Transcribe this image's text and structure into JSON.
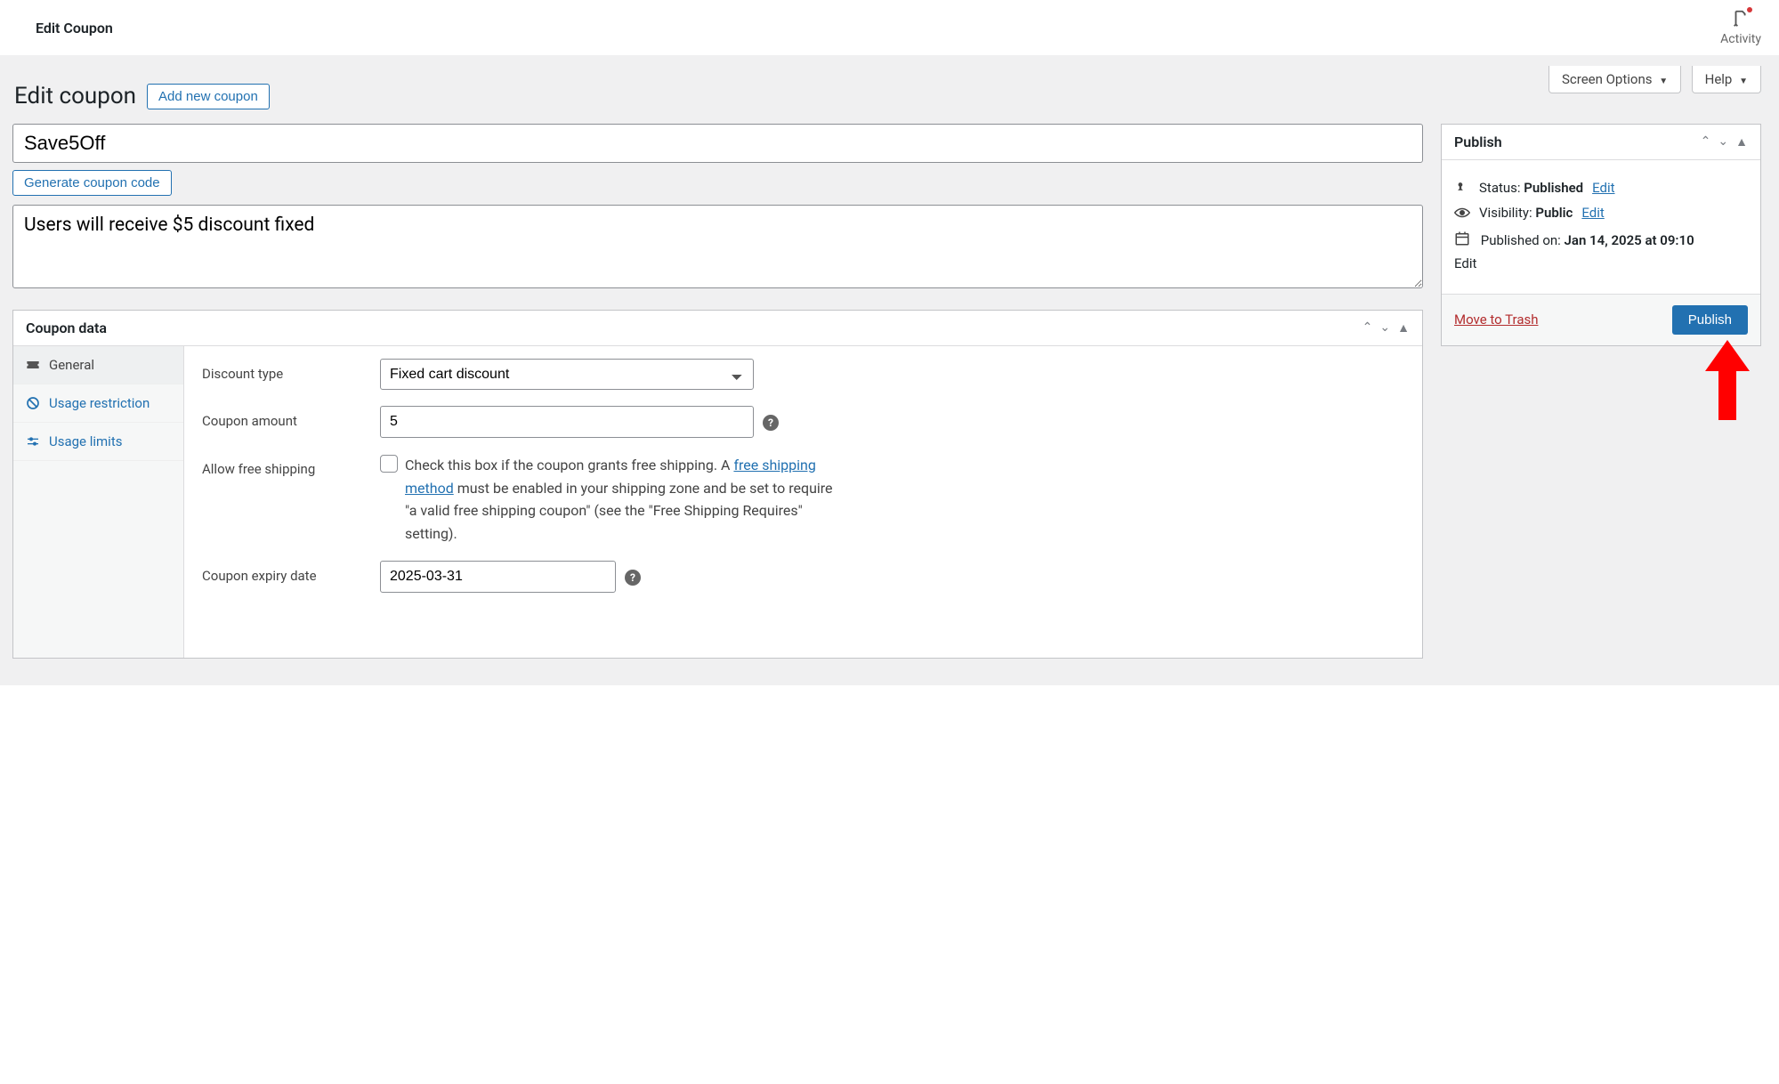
{
  "topbar": {
    "title": "Edit Coupon",
    "activity_label": "Activity"
  },
  "screen": {
    "options": "Screen Options",
    "help": "Help"
  },
  "heading": {
    "title": "Edit coupon",
    "add_new": "Add new coupon"
  },
  "form": {
    "coupon_code": "Save5Off",
    "generate_btn": "Generate coupon code",
    "description": "Users will receive $5 discount fixed"
  },
  "coupon_data": {
    "panel_title": "Coupon data",
    "tabs": {
      "general": "General",
      "usage_restriction": "Usage restriction",
      "usage_limits": "Usage limits"
    },
    "fields": {
      "discount_type_label": "Discount type",
      "discount_type_value": "Fixed cart discount",
      "coupon_amount_label": "Coupon amount",
      "coupon_amount_value": "5",
      "allow_free_shipping_label": "Allow free shipping",
      "free_shipping_text_1": "Check this box if the coupon grants free shipping. A ",
      "free_shipping_link": "free shipping method",
      "free_shipping_text_2": " must be enabled in your shipping zone and be set to require \"a valid free shipping coupon\" (see the \"Free Shipping Requires\" setting).",
      "expiry_label": "Coupon expiry date",
      "expiry_value": "2025-03-31"
    }
  },
  "publish": {
    "panel_title": "Publish",
    "status_label": "Status:",
    "status_value": "Published",
    "visibility_label": "Visibility:",
    "visibility_value": "Public",
    "published_on_label": "Published on:",
    "published_on_value": "Jan 14, 2025 at 09:10",
    "edit": "Edit",
    "trash": "Move to Trash",
    "publish_btn": "Publish"
  }
}
